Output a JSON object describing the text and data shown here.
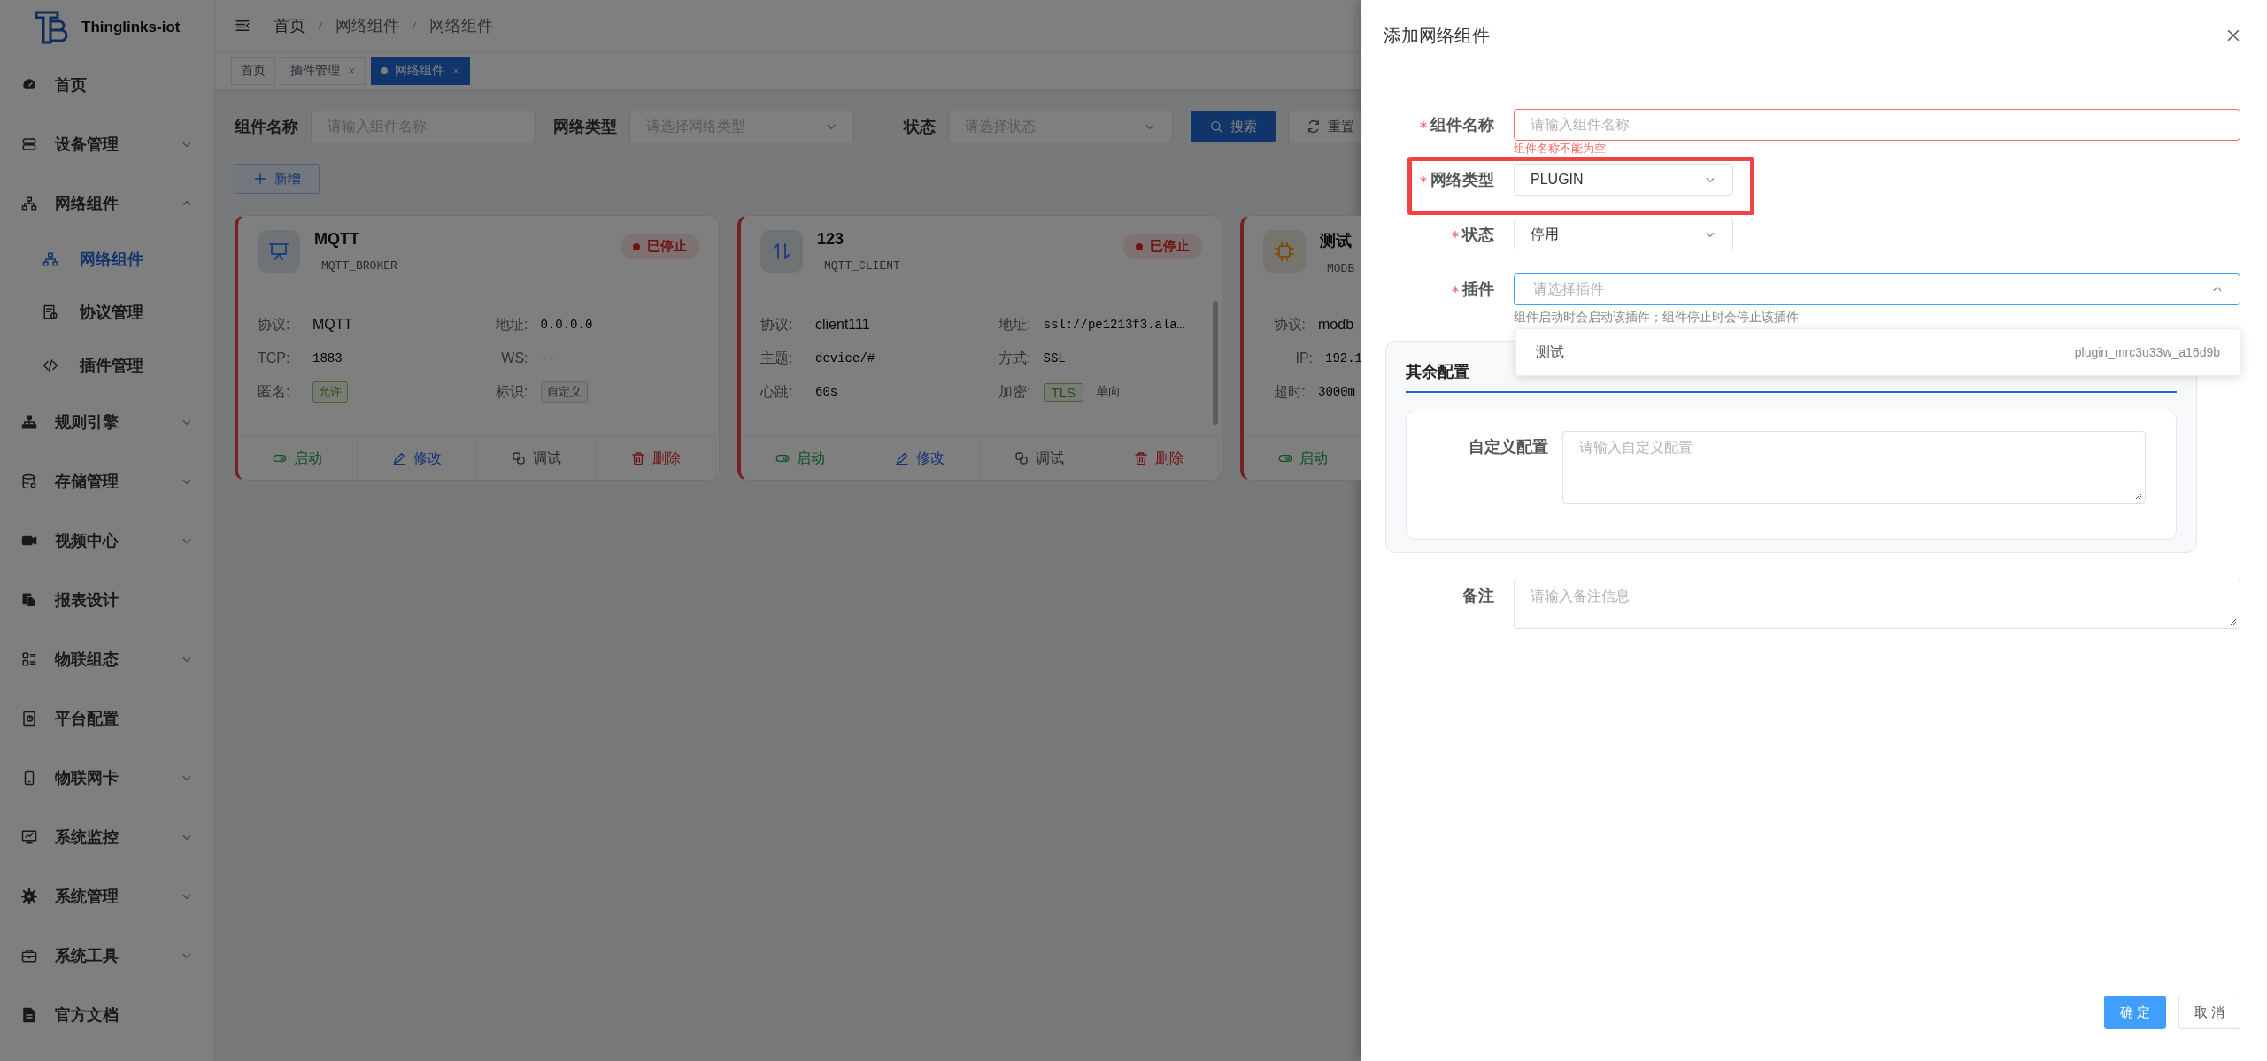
{
  "app": {
    "title": "Thinglinks-iot"
  },
  "sidebar": {
    "items": [
      {
        "label": "首页",
        "kind": "link",
        "selected": false
      },
      {
        "label": "设备管理",
        "kind": "group",
        "expanded": false,
        "selected": false
      },
      {
        "label": "网络组件",
        "kind": "group",
        "expanded": true,
        "selected": false,
        "children": [
          {
            "label": "网络组件",
            "selected": true
          },
          {
            "label": "协议管理",
            "selected": false
          },
          {
            "label": "插件管理",
            "selected": false
          }
        ]
      },
      {
        "label": "规则引擎",
        "kind": "group",
        "expanded": false,
        "selected": false
      },
      {
        "label": "存储管理",
        "kind": "group",
        "expanded": false,
        "selected": false
      },
      {
        "label": "视频中心",
        "kind": "group",
        "expanded": false,
        "selected": false
      },
      {
        "label": "报表设计",
        "kind": "link",
        "selected": false
      },
      {
        "label": "物联组态",
        "kind": "group",
        "expanded": false,
        "selected": false
      },
      {
        "label": "平台配置",
        "kind": "link",
        "selected": false
      },
      {
        "label": "物联网卡",
        "kind": "group",
        "expanded": false,
        "selected": false
      },
      {
        "label": "系统监控",
        "kind": "group",
        "expanded": false,
        "selected": false
      },
      {
        "label": "系统管理",
        "kind": "group",
        "expanded": false,
        "selected": false
      },
      {
        "label": "系统工具",
        "kind": "group",
        "expanded": false,
        "selected": false
      },
      {
        "label": "官方文档",
        "kind": "link",
        "selected": false
      }
    ]
  },
  "header": {
    "breadcrumb": [
      "首页",
      "网络组件",
      "网络组件"
    ]
  },
  "tabs": [
    {
      "label": "首页",
      "selected": false,
      "closable": false
    },
    {
      "label": "插件管理",
      "selected": false,
      "closable": true
    },
    {
      "label": "网络组件",
      "selected": true,
      "closable": true
    }
  ],
  "filters": [
    {
      "label": "组件名称",
      "kind": "text",
      "placeholder": "请输入组件名称"
    },
    {
      "label": "网络类型",
      "kind": "select",
      "placeholder": "请选择网络类型"
    },
    {
      "label": "状态",
      "kind": "select",
      "placeholder": "请选择状态"
    }
  ],
  "filter_buttons": [
    {
      "label": "搜索",
      "kind": "primary"
    },
    {
      "label": "重置",
      "kind": "default"
    }
  ],
  "add_button": "新增",
  "cards": [
    {
      "title": "MQTT",
      "type": "MQTT_BROKER",
      "status": "已停止",
      "running": false,
      "color": "#1e417b",
      "scroll": false,
      "kind": "grid",
      "fields": [
        {
          "label": "协议:",
          "value": "MQTT",
          "kind": "text"
        },
        {
          "label": "地址:",
          "value": "0.0.0.0",
          "kind": "mono"
        },
        {
          "label": "TCP:",
          "value": "1883",
          "kind": "mono"
        },
        {
          "label": "WS:",
          "value": "--",
          "kind": "mono"
        },
        {
          "label": "匿名:",
          "value": "允许",
          "kind": "tag"
        },
        {
          "label": "标识:",
          "value": "自定义",
          "kind": "tag_plain"
        }
      ],
      "actions": [
        {
          "label": "启动",
          "kind": "start"
        },
        {
          "label": "修改",
          "kind": "edit"
        },
        {
          "label": "调试",
          "kind": "debug"
        },
        {
          "label": "删除",
          "kind": "delete"
        }
      ]
    },
    {
      "title": "123",
      "type": "MQTT_CLIENT",
      "status": "已停止",
      "running": false,
      "color": "#1e417b",
      "scroll": true,
      "kind": "grid",
      "fields": [
        {
          "label": "协议:",
          "value": "client111",
          "kind": "text"
        },
        {
          "label": "地址:",
          "value": "ssl://pe1213f3.ala…",
          "kind": "mono"
        },
        {
          "label": "主题:",
          "value": "device/#",
          "kind": "mono"
        },
        {
          "label": "方式:",
          "value": "SSL",
          "kind": "mono"
        },
        {
          "label": "心跳:",
          "value": "60s",
          "kind": "mono"
        },
        {
          "label": "加密:",
          "value": "TLS",
          "kind": "tag",
          "note": "单向"
        }
      ],
      "actions": [
        {
          "label": "启动",
          "kind": "start"
        },
        {
          "label": "修改",
          "kind": "edit"
        },
        {
          "label": "调试",
          "kind": "debug"
        },
        {
          "label": "删除",
          "kind": "delete"
        }
      ]
    },
    {
      "title": "测试",
      "type": "MODB",
      "running": false,
      "color": "#7b5006",
      "scroll": false,
      "kind": "list",
      "fields": [
        {
          "label": "协议:",
          "value": "modb",
          "kind": "text"
        },
        {
          "label": "IP:",
          "value": "192.1",
          "kind": "mono"
        },
        {
          "label": "超时:",
          "value": "3000m",
          "kind": "mono"
        }
      ],
      "actions": [
        {
          "label": "启动",
          "kind": "start"
        }
      ]
    }
  ],
  "drawer": {
    "title": "添加网络组件",
    "fields": [
      {
        "label": "组件名称",
        "kind": "input",
        "required": true,
        "placeholder": "请输入组件名称",
        "error": "组件名称不能为空",
        "highlighted": false,
        "focused": false
      },
      {
        "label": "网络类型",
        "kind": "select",
        "required": true,
        "value": "PLUGIN",
        "highlighted": true,
        "focused": false,
        "open": false
      },
      {
        "label": "状态",
        "kind": "select",
        "required": true,
        "value": "停用",
        "highlighted": false,
        "focused": false,
        "open": false
      },
      {
        "label": "插件",
        "kind": "select",
        "required": true,
        "placeholder": "请选择插件",
        "hint": "组件启动时会启动该插件；组件停止时会停止该插件",
        "highlighted": false,
        "focused": true,
        "open": true,
        "options": [
          {
            "label": "测试",
            "value": "plugin_mrc3u33w_a16d9b"
          }
        ]
      }
    ],
    "section": {
      "title": "其余配置",
      "fields": [
        {
          "label": "自定义配置",
          "kind": "textarea",
          "placeholder": "请输入自定义配置"
        }
      ]
    },
    "remark": {
      "label": "备注",
      "placeholder": "请输入备注信息"
    },
    "buttons": [
      {
        "label": "确 定",
        "kind": "primary"
      },
      {
        "label": "取 消",
        "kind": "default"
      }
    ]
  }
}
